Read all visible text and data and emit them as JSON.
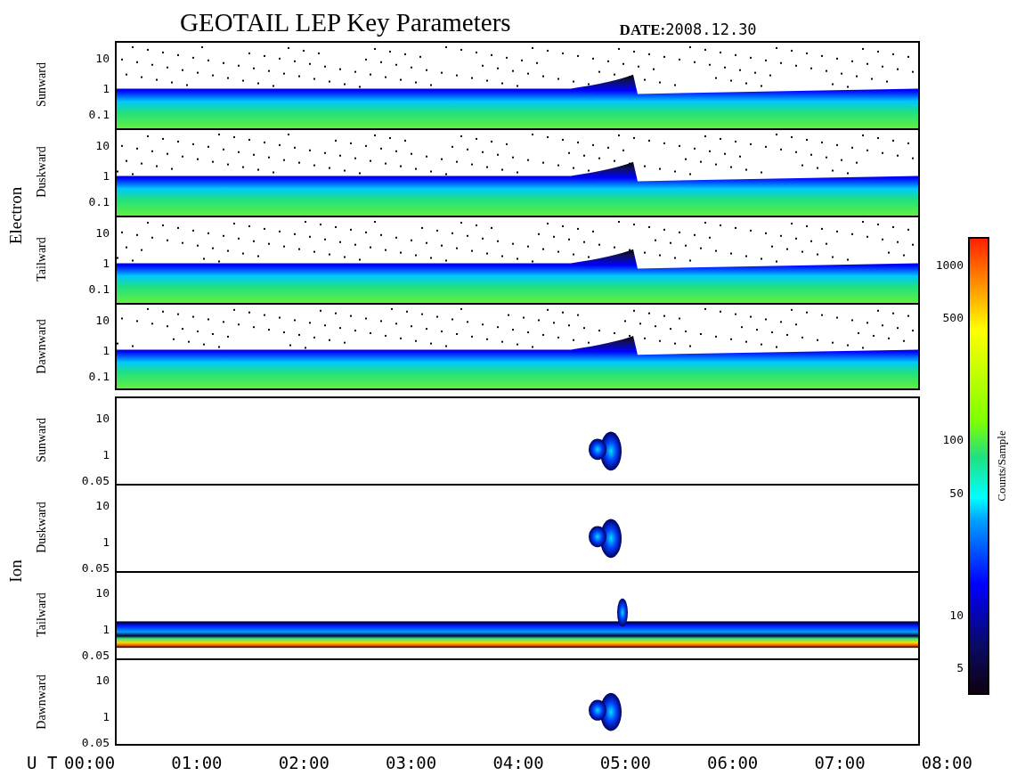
{
  "title": "GEOTAIL LEP Key Parameters",
  "date_label": "DATE:",
  "date": "2008.12.30",
  "groups": [
    {
      "name": "Electron",
      "panels": [
        {
          "direction": "Sunward",
          "kind": "band",
          "yticks": [
            "10",
            "1",
            "0.1"
          ]
        },
        {
          "direction": "Duskward",
          "kind": "band",
          "yticks": [
            "10",
            "1",
            "0.1"
          ]
        },
        {
          "direction": "Tailward",
          "kind": "band",
          "yticks": [
            "10",
            "1",
            "0.1"
          ]
        },
        {
          "direction": "Dawnward",
          "kind": "band",
          "yticks": [
            "10",
            "1",
            "0.1"
          ]
        }
      ]
    },
    {
      "name": "Ion",
      "panels": [
        {
          "direction": "Sunward",
          "kind": "burst",
          "yticks": [
            "10",
            "1",
            "0.05"
          ]
        },
        {
          "direction": "Duskward",
          "kind": "burst",
          "yticks": [
            "10",
            "1",
            "0.05"
          ]
        },
        {
          "direction": "Tailward",
          "kind": "band-burst",
          "yticks": [
            "10",
            "1",
            "0.05"
          ]
        },
        {
          "direction": "Dawnward",
          "kind": "burst",
          "yticks": [
            "10",
            "1",
            "0.05"
          ]
        }
      ]
    }
  ],
  "x_axis": {
    "label": "U T",
    "ticks": [
      "00:00",
      "01:00",
      "02:00",
      "03:00",
      "04:00",
      "05:00",
      "06:00",
      "07:00",
      "08:00"
    ]
  },
  "colorbar": {
    "label": "Counts/Sample",
    "ticks": [
      "1000",
      "500",
      "100",
      "50",
      "10",
      "5"
    ]
  }
}
